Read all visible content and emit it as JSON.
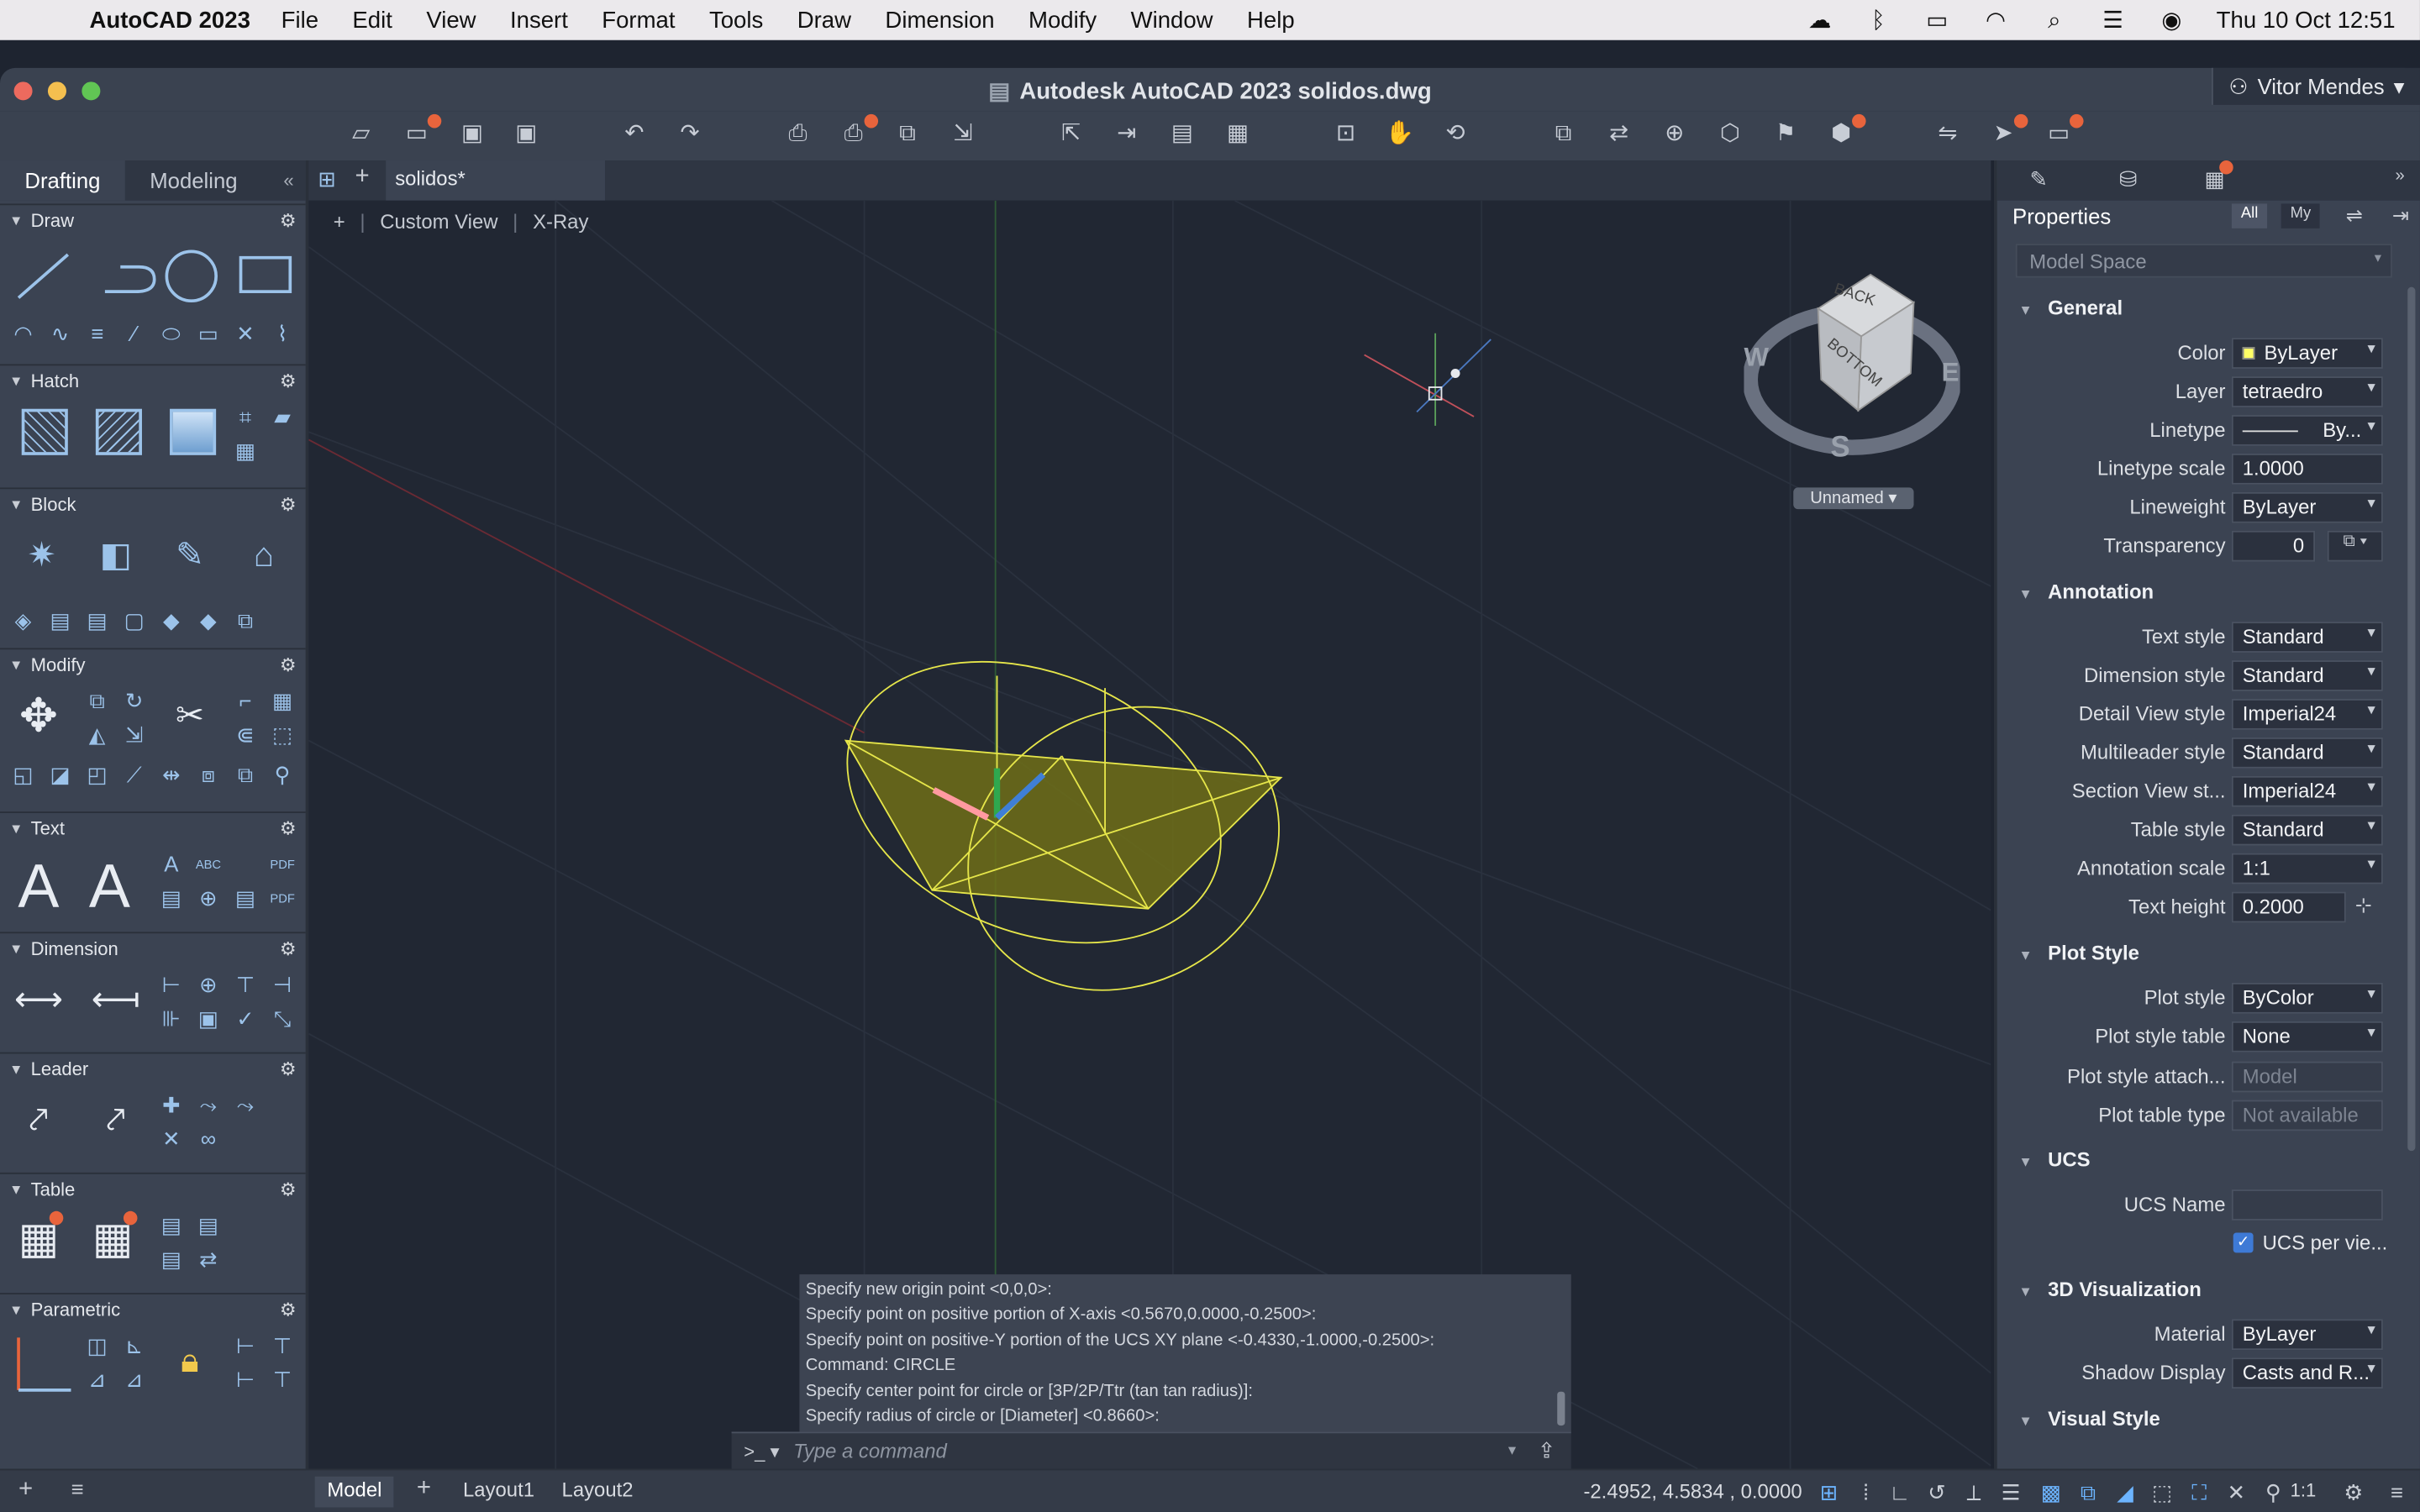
{
  "menubar": {
    "app_name": "AutoCAD 2023",
    "items": [
      "File",
      "Edit",
      "View",
      "Insert",
      "Format",
      "Tools",
      "Draw",
      "Dimension",
      "Modify",
      "Window",
      "Help"
    ],
    "datetime": "Thu 10 Oct  12:51"
  },
  "window": {
    "title": "Autodesk AutoCAD 2023    solidos.dwg",
    "user": "Vitor Mendes"
  },
  "palette": {
    "tabs": [
      "Drafting",
      "Modeling"
    ],
    "active_tab": "Drafting",
    "sections": [
      "Draw",
      "Hatch",
      "Block",
      "Modify",
      "Text",
      "Dimension",
      "Leader",
      "Table",
      "Parametric"
    ]
  },
  "document": {
    "tab": "solidos*",
    "view_labels": [
      "+",
      "Custom View",
      "X-Ray"
    ],
    "viewcube": {
      "labels": [
        "BACK",
        "BOTTOM",
        "W",
        "E",
        "S"
      ],
      "ucs_name": "Unnamed"
    }
  },
  "command": {
    "history": [
      "Specify new origin point <0,0,0>:",
      "Specify point on positive portion of X-axis <0.5670,0.0000,-0.2500>:",
      "Specify point on positive-Y portion of the UCS XY plane <-0.4330,-1.0000,-0.2500>:",
      "Command: CIRCLE",
      "Specify center point for circle or [3P/2P/Ttr (tan tan radius)]:",
      "Specify radius of circle or [Diameter] <0.8660>:"
    ],
    "prompt": ">_",
    "placeholder": "Type a command"
  },
  "status": {
    "layouts": [
      "Model",
      "Layout1",
      "Layout2"
    ],
    "coordinates": "-2.4952, 4.5834 , 0.0000",
    "scale": "1:1"
  },
  "properties": {
    "title": "Properties",
    "filter": [
      "All",
      "My"
    ],
    "scope": "Model Space",
    "groups": {
      "general": "General",
      "annotation": "Annotation",
      "plot": "Plot Style",
      "ucs": "UCS",
      "viz3d": "3D Visualization",
      "visual": "Visual Style"
    },
    "general": {
      "color": {
        "label": "Color",
        "value": "ByLayer"
      },
      "layer": {
        "label": "Layer",
        "value": "tetraedro"
      },
      "linetype": {
        "label": "Linetype",
        "value": "By..."
      },
      "linetype_scale": {
        "label": "Linetype scale",
        "value": "1.0000"
      },
      "lineweight": {
        "label": "Lineweight",
        "value": "ByLayer"
      },
      "transparency": {
        "label": "Transparency",
        "value": "0"
      }
    },
    "annotation": {
      "text_style": {
        "label": "Text style",
        "value": "Standard"
      },
      "dimension_style": {
        "label": "Dimension style",
        "value": "Standard"
      },
      "detail_view_style": {
        "label": "Detail View style",
        "value": "Imperial24"
      },
      "multileader_style": {
        "label": "Multileader style",
        "value": "Standard"
      },
      "section_view_style": {
        "label": "Section View st...",
        "value": "Imperial24"
      },
      "table_style": {
        "label": "Table style",
        "value": "Standard"
      },
      "annotation_scale": {
        "label": "Annotation scale",
        "value": "1:1"
      },
      "text_height": {
        "label": "Text height",
        "value": "0.2000"
      }
    },
    "plot": {
      "plot_style": {
        "label": "Plot style",
        "value": "ByColor"
      },
      "plot_style_table": {
        "label": "Plot style table",
        "value": "None"
      },
      "plot_style_attach": {
        "label": "Plot style attach...",
        "value": "Model"
      },
      "plot_table_type": {
        "label": "Plot table type",
        "value": "Not available"
      }
    },
    "ucs": {
      "ucs_name": {
        "label": "UCS Name",
        "value": ""
      },
      "ucs_per_view": {
        "label": "UCS per vie..."
      }
    },
    "viz3d": {
      "material": {
        "label": "Material",
        "value": "ByLayer"
      },
      "shadow_display": {
        "label": "Shadow Display",
        "value": "Casts and R..."
      }
    }
  },
  "colors": {
    "accent": "#6cb4ff",
    "badge": "#e8643c",
    "solid_fill": "#7a7a1a",
    "solid_edge": "#e6e64a",
    "background": "#212733"
  }
}
